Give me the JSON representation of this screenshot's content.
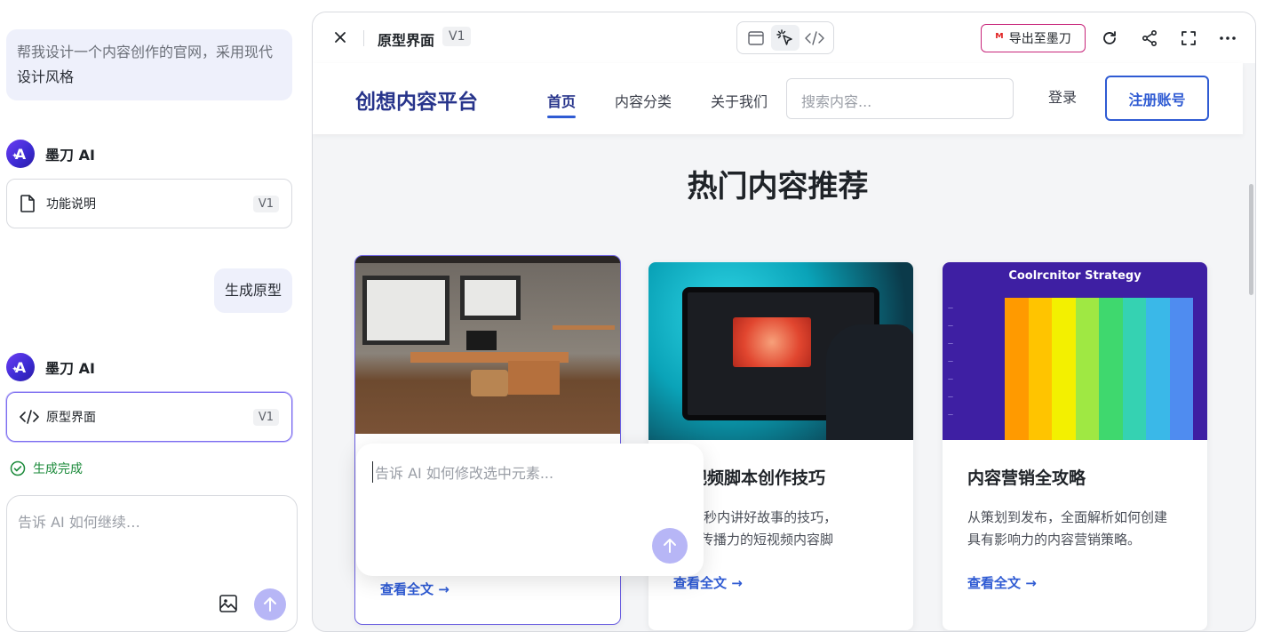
{
  "chat": {
    "user_msg_1_line1": "帮我设计一个内容创作的官网，采用现代",
    "user_msg_1_line2": "设计风格",
    "ai_name": "墨刀 AI",
    "card_1": {
      "label": "功能说明",
      "version": "V1"
    },
    "user_msg_2": "生成原型",
    "card_2": {
      "label": "原型界面",
      "version": "V1"
    },
    "status": "生成完成",
    "composer_placeholder": "告诉 AI 如何继续…"
  },
  "preview": {
    "title": "原型界面",
    "version": "V1",
    "export_label": "导出至墨刀",
    "export_logo": "ᴹ",
    "site": {
      "logo": "创想内容平台",
      "nav": [
        "首页",
        "内容分类",
        "关于我们"
      ],
      "search_placeholder": "搜索内容...",
      "login": "登录",
      "register": "注册账号",
      "section_title": "热门内容推荐",
      "articles": [
        {
          "title": "",
          "desc_1": "",
          "desc_2": "",
          "link": "查看全文 →"
        },
        {
          "title": "短视频脚本创作技巧",
          "desc_1": "在30秒内讲好故事的技巧，",
          "desc_2": "具有传播力的短视频内容脚",
          "link": "查看全文 →"
        },
        {
          "title": "内容营销全攻略",
          "desc_1": "从策划到发布，全面解析如何创建",
          "desc_2": "具有影响力的内容营销策略。",
          "link": "查看全文 →"
        }
      ],
      "heatmap_title": "Coolrcnitor Strategy"
    },
    "popup_placeholder": "告诉 AI 如何修改选中元素..."
  },
  "colors": {
    "brand": "#27348b",
    "accent": "#2f5bd3",
    "ai_purple": "#6a5ee0",
    "success": "#1b8a3a"
  }
}
